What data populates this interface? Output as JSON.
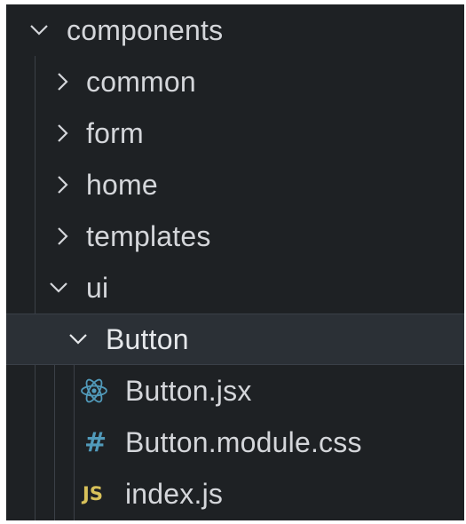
{
  "explorer": {
    "root": {
      "label": "components",
      "icon": "chevron-down-icon",
      "expanded": true
    },
    "folders": [
      {
        "label": "common",
        "icon": "chevron-right-icon",
        "expanded": false
      },
      {
        "label": "form",
        "icon": "chevron-right-icon",
        "expanded": false
      },
      {
        "label": "home",
        "icon": "chevron-right-icon",
        "expanded": false
      },
      {
        "label": "templates",
        "icon": "chevron-right-icon",
        "expanded": false
      },
      {
        "label": "ui",
        "icon": "chevron-down-icon",
        "expanded": true
      }
    ],
    "subfolder": {
      "label": "Button",
      "icon": "chevron-down-icon",
      "expanded": true,
      "selected": true
    },
    "files": [
      {
        "label": "Button.jsx",
        "icon": "react-icon",
        "icon_color": "#519aba"
      },
      {
        "label": "Button.module.css",
        "icon": "css-hash-icon",
        "icon_text": "#",
        "icon_color": "#519aba"
      },
      {
        "label": "index.js",
        "icon": "js-icon",
        "icon_text": "JS",
        "icon_color": "#d8c15a"
      }
    ]
  },
  "colors": {
    "background": "#1e2124",
    "text": "#d4d6da",
    "selected_background": "#2b3036",
    "indent_guide": "#3b4047"
  }
}
